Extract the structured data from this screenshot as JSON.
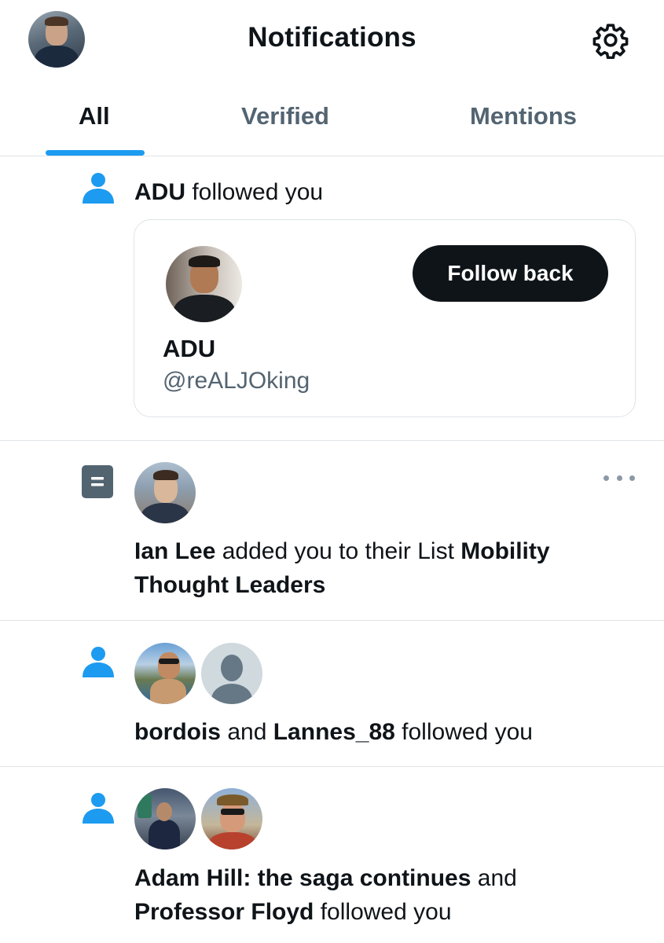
{
  "header": {
    "title": "Notifications",
    "avatar_icon": "profile-avatar",
    "settings_icon": "gear-icon"
  },
  "tabs": [
    {
      "label": "All",
      "active": true
    },
    {
      "label": "Verified",
      "active": false
    },
    {
      "label": "Mentions",
      "active": false
    }
  ],
  "colors": {
    "accent": "#1d9bf0",
    "text_primary": "#0f1419",
    "text_secondary": "#536471",
    "divider": "#dfe4e8",
    "follow_icon": "#1d9bf0",
    "list_icon": "#536471"
  },
  "notifications": [
    {
      "type_icon": "person-icon",
      "actor": "ADU",
      "text": " followed you",
      "card": {
        "name": "ADU",
        "handle": "@reALJOking",
        "button_label": "Follow back"
      }
    },
    {
      "type_icon": "list-icon",
      "actor": "Ian Lee",
      "text": " added you to their List ",
      "list_name": "Mobility Thought Leaders",
      "more_icon": "more-horizontal-icon"
    },
    {
      "type_icon": "person-icon",
      "actor1": "bordois",
      "conj": " and ",
      "actor2": "Lannes_88",
      "text": " followed you"
    },
    {
      "type_icon": "person-icon",
      "actor1": "Adam Hill: the saga continues",
      "conj": " and ",
      "actor2": "Professor Floyd",
      "text": " followed you"
    }
  ]
}
